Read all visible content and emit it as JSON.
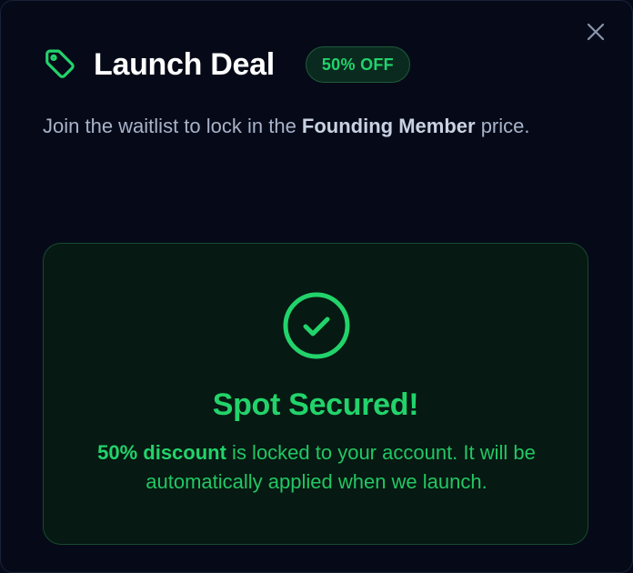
{
  "modal": {
    "title": "Launch Deal",
    "badge": "50% OFF",
    "subtitle_prefix": "Join the waitlist to lock in the ",
    "subtitle_strong": "Founding Member",
    "subtitle_suffix": " price.",
    "close_icon": "close-icon",
    "tag_icon": "tag-icon"
  },
  "success": {
    "icon": "check-circle-icon",
    "title": "Spot Secured!",
    "message_strong": "50% discount",
    "message_rest": " is locked to your account. It will be automatically applied when we launch."
  },
  "colors": {
    "background": "#060a18",
    "accent_green": "#22d36b",
    "card_background": "#061912",
    "card_border": "#174a32",
    "muted_text": "#a8b3c9"
  }
}
